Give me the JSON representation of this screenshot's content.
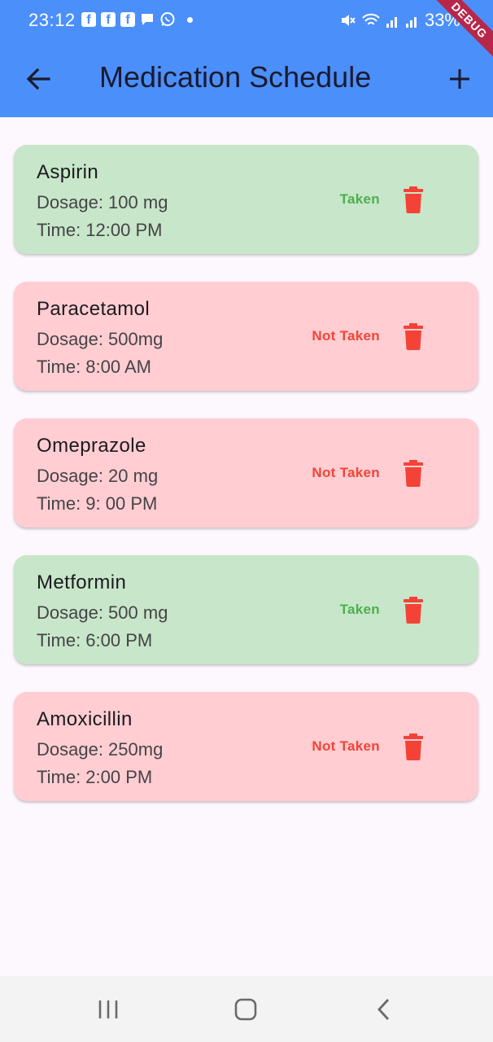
{
  "status_bar": {
    "time": "23:12",
    "battery": "33%",
    "notification_icons": [
      "facebook-icon",
      "facebook-icon",
      "facebook-icon",
      "message-icon",
      "whatsapp-icon",
      "dot-icon"
    ],
    "system_icons": [
      "mute-icon",
      "wifi-icon",
      "signal-icon",
      "signal-icon",
      "battery-icon"
    ]
  },
  "debug_banner": "DEBUG",
  "app_bar": {
    "title": "Medication Schedule",
    "back_icon": "arrow-left-icon",
    "add_icon": "plus-icon",
    "color": "#4b8ffa"
  },
  "medications": [
    {
      "name": "Aspirin",
      "dosage": "Dosage: 100 mg",
      "time": "Time: 12:00 PM",
      "status": "Taken",
      "taken": true
    },
    {
      "name": "Paracetamol",
      "dosage": "Dosage: 500mg",
      "time": "Time: 8:00 AM",
      "status": "Not Taken",
      "taken": false
    },
    {
      "name": "Omeprazole",
      "dosage": "Dosage: 20 mg",
      "time": "Time: 9: 00 PM",
      "status": "Not Taken",
      "taken": false
    },
    {
      "name": "Metformin",
      "dosage": "Dosage: 500 mg",
      "time": "Time: 6:00 PM",
      "status": "Taken",
      "taken": true
    },
    {
      "name": "Amoxicillin",
      "dosage": "Dosage: 250mg",
      "time": "Time: 2:00 PM",
      "status": "Not Taken",
      "taken": false
    }
  ],
  "colors": {
    "taken_bg": "#c8e6c9",
    "not_taken_bg": "#ffcdd2",
    "taken_text": "#4caf50",
    "not_taken_text": "#f44336",
    "delete_icon": "#f44336"
  },
  "nav_bar": {
    "icons": [
      "recents-icon",
      "home-icon",
      "back-icon"
    ]
  }
}
